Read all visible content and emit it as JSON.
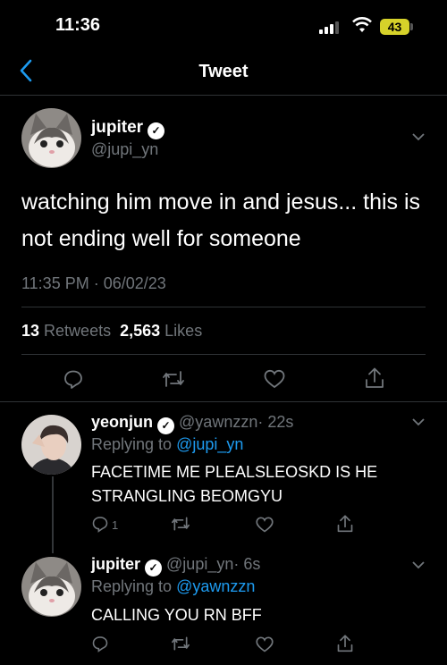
{
  "status_bar": {
    "time": "11:36",
    "battery": "43"
  },
  "nav": {
    "title": "Tweet"
  },
  "main_tweet": {
    "name": "jupiter",
    "handle": "@jupi_yn",
    "text": "watching him move in and jesus... this is not ending well for someone",
    "timestamp": "11:35 PM · 06/02/23",
    "retweets_count": "13",
    "retweets_label": "Retweets",
    "likes_count": "2,563",
    "likes_label": "Likes"
  },
  "replies": [
    {
      "name": "yeonjun",
      "handle": "@yawnzzn",
      "time": "· 22s",
      "replying_prefix": "Replying to",
      "replying_to": "@jupi_yn",
      "text": "FACETIME ME PLEALSLEOSKD IS HE STRANGLING BEOMGYU",
      "reply_count": "1"
    },
    {
      "name": "jupiter",
      "handle": "@jupi_yn",
      "time": "· 6s",
      "replying_prefix": "Replying to",
      "replying_to": "@yawnzzn",
      "text": "CALLING YOU RN BFF",
      "reply_count": ""
    }
  ],
  "colors": {
    "accent": "#1d9bf0",
    "verified": "#ffffff",
    "battery": "#d6d22a"
  },
  "icons": [
    "back-icon",
    "verified-icon",
    "chevron-down-icon",
    "reply-icon",
    "retweet-icon",
    "like-icon",
    "share-icon",
    "signal-icon",
    "wifi-icon"
  ]
}
